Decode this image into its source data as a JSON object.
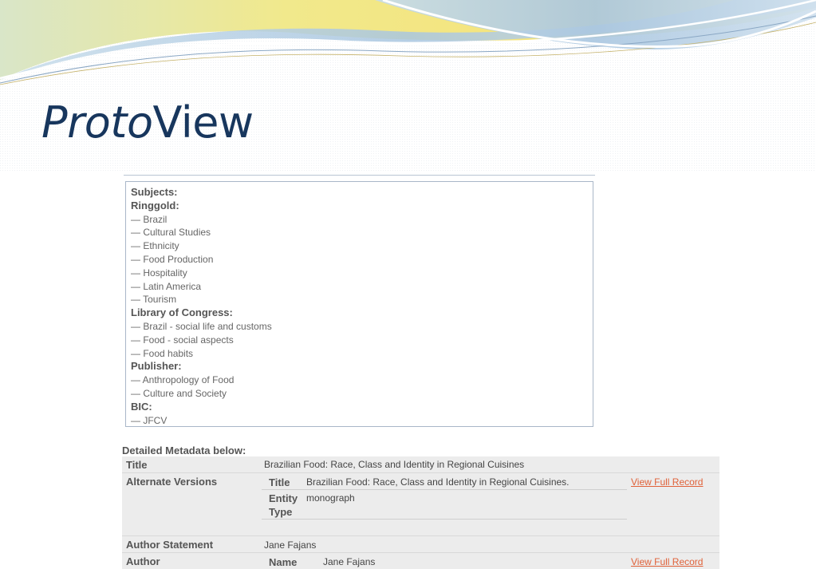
{
  "slide": {
    "title_italic": "Proto",
    "title_regular": "View"
  },
  "subjects": {
    "heading": "Subjects:",
    "groups": [
      {
        "name": "Ringgold:",
        "items": [
          "— Brazil",
          "— Cultural Studies",
          "— Ethnicity",
          "— Food Production",
          "— Hospitality",
          "— Latin America",
          "— Tourism"
        ]
      },
      {
        "name": "Library of Congress:",
        "items": [
          "— Brazil - social life and customs",
          "— Food - social aspects",
          "— Food habits"
        ]
      },
      {
        "name": "Publisher:",
        "items": [
          "— Anthropology of Food",
          "— Culture and Society"
        ]
      },
      {
        "name": "BIC:",
        "items": [
          "— JFCV"
        ]
      }
    ]
  },
  "metadata": {
    "heading": "Detailed Metadata below:",
    "title": {
      "label": "Title",
      "value": "Brazilian Food: Race, Class and Identity in Regional Cuisines"
    },
    "alternate_versions": {
      "label": "Alternate Versions",
      "title_key": "Title",
      "title_value": "Brazilian Food: Race, Class and Identity in Regional Cuisines.",
      "entity_key_1": "Entity",
      "entity_key_2": "Type",
      "entity_value": "monograph",
      "link": "View Full Record"
    },
    "author_statement": {
      "label": "Author Statement",
      "value": "Jane Fajans"
    },
    "author": {
      "label": "Author",
      "name_key": "Name",
      "name_value": "Jane Fajans",
      "link": "View Full Record"
    }
  },
  "colors": {
    "title": "#17365d",
    "link": "#e0623a",
    "wave_yellow": "#f3e47a",
    "wave_blue": "#b9d3e8"
  }
}
